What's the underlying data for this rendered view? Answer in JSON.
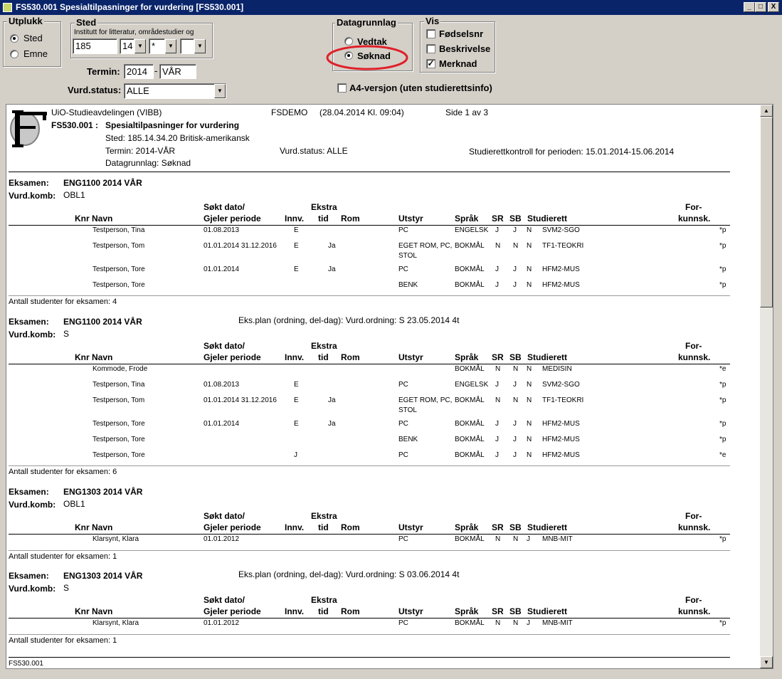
{
  "window": {
    "title": "FS530.001 Spesialtilpasninger for vurdering [FS530.001]",
    "btn_min": "_",
    "btn_max": "□",
    "btn_close": "X"
  },
  "utplukk": {
    "title": "Utplukk",
    "opt1": "Sted",
    "opt2": "Emne"
  },
  "sted": {
    "title": "Sted",
    "sub": "Institutt for litteratur, områdestudier og",
    "code": "185",
    "sub2": "14",
    "sub3": "*",
    "sub4": ""
  },
  "termin": {
    "label": "Termin:",
    "year": "2014",
    "sep": "-",
    "sem": "VÅR"
  },
  "vurdstatus": {
    "label": "Vurd.status:",
    "value": "ALLE"
  },
  "datagrunnlag": {
    "title": "Datagrunnlag",
    "opt1": "Vedtak",
    "opt2": "Søknad"
  },
  "vis": {
    "title": "Vis",
    "opt1": "Fødselsnr",
    "opt2": "Beskrivelse",
    "opt3": "Merknad",
    "check": "✓"
  },
  "a4": {
    "label": "A4-versjon (uten studierettsinfo)"
  },
  "report": {
    "org": "UiO-Studieavdelingen (VIBB)",
    "db": "FSDEMO",
    "when": "(28.04.2014 Kl. 09:04)",
    "page": "Side 1 av 3",
    "code_title": "FS530.001 :",
    "title": "Spesialtilpasninger for vurdering",
    "sted": "Sted: 185.14.34.20 Britisk-amerikansk",
    "termin": "Termin:  2014-VÅR",
    "datagrunnlag": "Datagrunnlag:    Søknad",
    "vurdstatus": "Vurd.status: ALLE",
    "kontroll": "Studierettkontroll for perioden: 15.01.2014-15.06.2014",
    "footer": "FS530.001"
  },
  "hdr": {
    "eksamen": "Eksamen:",
    "vurdkomb": "Vurd.komb:",
    "knr_navn": "Knr Navn",
    "sokt1": "Søkt dato/",
    "sokt2": "Gjeler periode",
    "innv": "Innv.",
    "ekstra1": "Ekstra",
    "ekstra2": "tid",
    "rom": "Rom",
    "utstyr": "Utstyr",
    "sprak": "Språk",
    "sr": "SR",
    "sb": "SB",
    "studierett": "Studierett",
    "for1": "For-",
    "for2": "kunnsk."
  },
  "sections": [
    {
      "exam": "ENG1100 2014 VÅR",
      "komb": "OBL1",
      "plan": "",
      "count": "Antall studenter for eksamen: 4",
      "rows": [
        {
          "name": "Testperson, Tina",
          "date": "01.08.2013",
          "innv": "E",
          "ekstra": "",
          "utstyr": "PC",
          "utstyr2": "",
          "sprak": "ENGELSK",
          "sr": "J",
          "sb": "J",
          "n": "N",
          "rett": "SVM2-SGO",
          "fk": "*p"
        },
        {
          "name": "Testperson, Tom",
          "date": "01.01.2014  31.12.2016",
          "innv": "E",
          "ekstra": "Ja",
          "utstyr": "EGET ROM, PC,",
          "utstyr2": "STOL",
          "sprak": "BOKMÅL",
          "sr": "N",
          "sb": "N",
          "n": "N",
          "rett": "TF1-TEOKRI",
          "fk": "*p"
        },
        {
          "name": "Testperson, Tore",
          "date": "01.01.2014",
          "innv": "E",
          "ekstra": "Ja",
          "utstyr": "PC",
          "utstyr2": "",
          "sprak": "BOKMÅL",
          "sr": "J",
          "sb": "J",
          "n": "N",
          "rett": "HFM2-MUS",
          "fk": "*p"
        },
        {
          "name": "Testperson, Tore",
          "date": "",
          "innv": "",
          "ekstra": "",
          "utstyr": "BENK",
          "utstyr2": "",
          "sprak": "BOKMÅL",
          "sr": "J",
          "sb": "J",
          "n": "N",
          "rett": "HFM2-MUS",
          "fk": "*p"
        }
      ]
    },
    {
      "exam": "ENG1100 2014 VÅR",
      "komb": "S",
      "plan": "Eks.plan (ordning, del-dag):  Vurd.ordning: S 23.05.2014 4t",
      "count": "Antall studenter for eksamen: 6",
      "rows": [
        {
          "name": "Kommode, Frode",
          "date": "",
          "innv": "",
          "ekstra": "",
          "utstyr": "",
          "utstyr2": "",
          "sprak": "BOKMÅL",
          "sr": "N",
          "sb": "N",
          "n": "N",
          "rett": "MEDISIN",
          "fk": "*e"
        },
        {
          "name": "Testperson, Tina",
          "date": "01.08.2013",
          "innv": "E",
          "ekstra": "",
          "utstyr": "PC",
          "utstyr2": "",
          "sprak": "ENGELSK",
          "sr": "J",
          "sb": "J",
          "n": "N",
          "rett": "SVM2-SGO",
          "fk": "*p"
        },
        {
          "name": "Testperson, Tom",
          "date": "01.01.2014  31.12.2016",
          "innv": "E",
          "ekstra": "Ja",
          "utstyr": "EGET ROM, PC,",
          "utstyr2": "STOL",
          "sprak": "BOKMÅL",
          "sr": "N",
          "sb": "N",
          "n": "N",
          "rett": "TF1-TEOKRI",
          "fk": "*p"
        },
        {
          "name": "Testperson, Tore",
          "date": "01.01.2014",
          "innv": "E",
          "ekstra": "Ja",
          "utstyr": "PC",
          "utstyr2": "",
          "sprak": "BOKMÅL",
          "sr": "J",
          "sb": "J",
          "n": "N",
          "rett": "HFM2-MUS",
          "fk": "*p"
        },
        {
          "name": "Testperson, Tore",
          "date": "",
          "innv": "",
          "ekstra": "",
          "utstyr": "BENK",
          "utstyr2": "",
          "sprak": "BOKMÅL",
          "sr": "J",
          "sb": "J",
          "n": "N",
          "rett": "HFM2-MUS",
          "fk": "*p"
        },
        {
          "name": "Testperson, Tore",
          "date": "",
          "innv": "J",
          "ekstra": "",
          "utstyr": "PC",
          "utstyr2": "",
          "sprak": "BOKMÅL",
          "sr": "J",
          "sb": "J",
          "n": "N",
          "rett": "HFM2-MUS",
          "fk": "*e"
        }
      ]
    },
    {
      "exam": "ENG1303 2014 VÅR",
      "komb": "OBL1",
      "plan": "",
      "count": "Antall studenter for eksamen: 1",
      "rows": [
        {
          "name": "Klarsynt, Klara",
          "date": "01.01.2012",
          "innv": "",
          "ekstra": "",
          "utstyr": "PC",
          "utstyr2": "",
          "sprak": "BOKMÅL",
          "sr": "N",
          "sb": "N",
          "n": "J",
          "rett": "MNB-MIT",
          "fk": "*p"
        }
      ]
    },
    {
      "exam": "ENG1303 2014 VÅR",
      "komb": "S",
      "plan": "Eks.plan (ordning, del-dag):  Vurd.ordning: S 03.06.2014 4t",
      "count": "Antall studenter for eksamen: 1",
      "rows": [
        {
          "name": "Klarsynt, Klara",
          "date": "01.01.2012",
          "innv": "",
          "ekstra": "",
          "utstyr": "PC",
          "utstyr2": "",
          "sprak": "BOKMÅL",
          "sr": "N",
          "sb": "N",
          "n": "J",
          "rett": "MNB-MIT",
          "fk": "*p"
        }
      ]
    }
  ],
  "colors": {
    "titlebar": "#0a246a",
    "annotation": "#e0202a"
  }
}
